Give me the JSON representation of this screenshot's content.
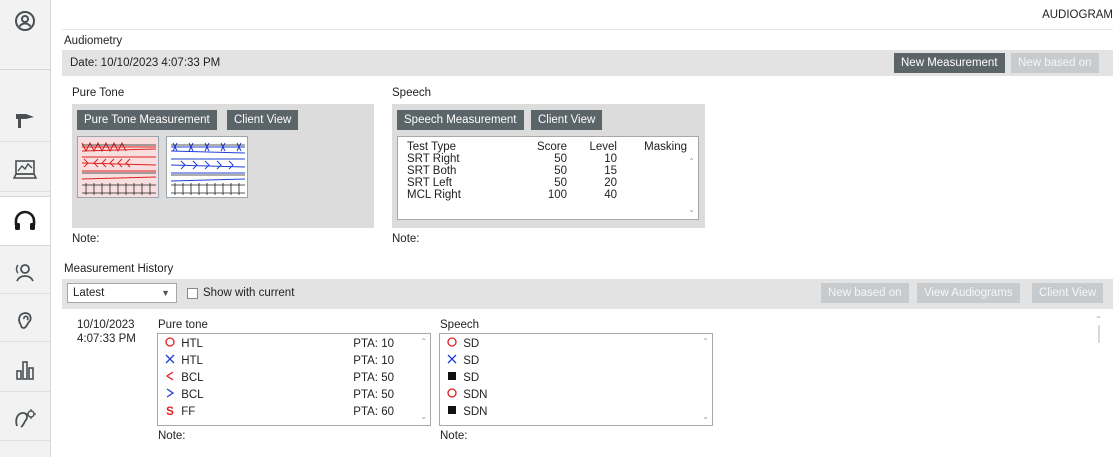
{
  "header": {
    "title": "AUDIOGRAM"
  },
  "audiometry": {
    "section_label": "Audiometry",
    "date": "Date: 10/10/2023 4:07:33 PM",
    "new_measurement_label": "New Measurement",
    "new_based_on_label": "New based on",
    "pure_tone": {
      "label": "Pure Tone",
      "measure_button": "Pure Tone Measurement",
      "client_view_button": "Client View",
      "note": "Note:"
    },
    "speech": {
      "label": "Speech",
      "measure_button": "Speech Measurement",
      "client_view_button": "Client View",
      "note": "Note:",
      "columns": [
        "Test Type",
        "Score",
        "Level",
        "Masking"
      ],
      "rows": [
        {
          "type": "SRT Right",
          "score": "50",
          "level": "10",
          "masking": ""
        },
        {
          "type": "SRT Both",
          "score": "50",
          "level": "15",
          "masking": ""
        },
        {
          "type": "SRT Left",
          "score": "50",
          "level": "20",
          "masking": ""
        },
        {
          "type": "MCL Right",
          "score": "100",
          "level": "40",
          "masking": ""
        }
      ]
    }
  },
  "history": {
    "section_label": "Measurement History",
    "filter_value": "Latest",
    "show_with_current_label": "Show with current",
    "new_based_on_label": "New based on",
    "view_audiograms_label": "View Audiograms",
    "client_view_label": "Client View",
    "entry": {
      "date": "10/10/2023",
      "time": "4:07:33 PM",
      "pure_tone_label": "Pure tone",
      "speech_label": "Speech",
      "note_pt": "Note:",
      "note_sp": "Note:",
      "pure_tone_rows": [
        {
          "symbol": "circle",
          "symbol_color": "#e02020",
          "label": "HTL",
          "pta": "PTA: 10"
        },
        {
          "symbol": "cross",
          "symbol_color": "#1f3fd6",
          "label": "HTL",
          "pta": "PTA: 10"
        },
        {
          "symbol": "less-than",
          "symbol_color": "#e02020",
          "label": "BCL",
          "pta": "PTA: 50"
        },
        {
          "symbol": "greater-than",
          "symbol_color": "#1f3fd6",
          "label": "BCL",
          "pta": "PTA: 50"
        },
        {
          "symbol": "S",
          "symbol_color": "#e02020",
          "label": "FF",
          "pta": "PTA: 60"
        }
      ],
      "speech_rows": [
        {
          "symbol": "circle",
          "symbol_color": "#e02020",
          "label": "SD"
        },
        {
          "symbol": "cross",
          "symbol_color": "#1f3fd6",
          "label": "SD"
        },
        {
          "symbol": "square",
          "symbol_color": "#111111",
          "label": "SD"
        },
        {
          "symbol": "circle",
          "symbol_color": "#e02020",
          "label": "SDN"
        },
        {
          "symbol": "square",
          "symbol_color": "#111111",
          "label": "SDN"
        }
      ]
    }
  },
  "sidebar": {
    "items": [
      {
        "icon": "user-circle-icon",
        "active": false
      },
      {
        "icon": "otoscope-icon",
        "active": false
      },
      {
        "icon": "screen-graph-icon",
        "active": false
      },
      {
        "icon": "headphones-icon",
        "active": true
      },
      {
        "icon": "speaker-user-icon",
        "active": false
      },
      {
        "icon": "ear-icon",
        "active": false
      },
      {
        "icon": "bar-chart-icon",
        "active": false
      },
      {
        "icon": "hearing-aid-settings-icon",
        "active": false
      }
    ]
  }
}
